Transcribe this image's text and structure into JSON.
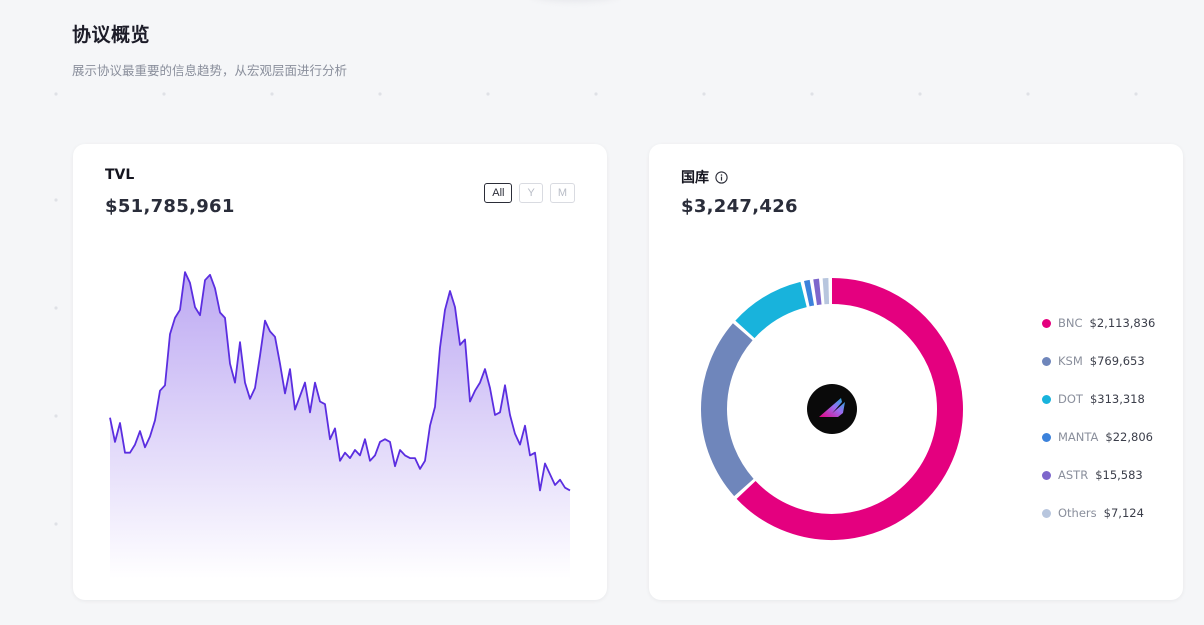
{
  "header": {
    "title": "协议概览",
    "subtitle": "展示协议最重要的信息趋势，从宏观层面进行分析"
  },
  "tvl": {
    "title": "TVL",
    "value": "$51,785,961",
    "ranges": [
      {
        "label": "All",
        "active": true
      },
      {
        "label": "Y",
        "active": false
      },
      {
        "label": "M",
        "active": false
      }
    ],
    "line_color": "#5b2ee0",
    "fill_color": "#b9a4f2"
  },
  "treasury": {
    "title": "国库",
    "info_icon": "info-circle-icon",
    "value": "$3,247,426",
    "center_logo": "bifrost-logo-icon"
  },
  "chart_data": [
    {
      "type": "area",
      "title": "TVL",
      "x": [
        0,
        5,
        10,
        15,
        20,
        25,
        30,
        35,
        40,
        45,
        50,
        55,
        60,
        65,
        70,
        75,
        80,
        85,
        90,
        95,
        100,
        105,
        110,
        115,
        120,
        125,
        130,
        135,
        140,
        145,
        150,
        155,
        160,
        165,
        170,
        175,
        180,
        185,
        190,
        195,
        200,
        205,
        210,
        215,
        220,
        225,
        230,
        235,
        240,
        245,
        250,
        255,
        260,
        265,
        270,
        275,
        280,
        285,
        290,
        295,
        300,
        305,
        310,
        315,
        320,
        325,
        330,
        335,
        340,
        345,
        350,
        355,
        360,
        365,
        370,
        375,
        380,
        385,
        390,
        395,
        400,
        405,
        410,
        415,
        420,
        425,
        430,
        435,
        440,
        445,
        450,
        455,
        460
      ],
      "y": [
        58,
        49,
        56,
        45,
        45,
        48,
        53,
        47,
        51,
        57,
        68,
        70,
        89,
        95,
        98,
        112,
        108,
        99,
        96,
        109,
        111,
        106,
        97,
        95,
        78,
        71,
        86,
        71,
        65,
        69,
        81,
        94,
        90,
        88,
        78,
        67,
        76,
        61,
        66,
        71,
        60,
        71,
        64,
        63,
        50,
        54,
        42,
        45,
        43,
        46,
        44,
        50,
        42,
        44,
        49,
        50,
        49,
        40,
        46,
        44,
        43,
        43,
        39,
        42,
        55,
        62,
        84,
        98,
        105,
        99,
        85,
        87,
        64,
        68,
        71,
        76,
        69,
        59,
        60,
        70,
        59,
        52,
        48,
        55,
        44,
        45,
        31,
        41,
        37,
        33,
        35,
        32,
        31
      ],
      "ylim": [
        0,
        115
      ]
    },
    {
      "type": "pie",
      "title": "国库",
      "total": "$3,247,426",
      "slices": [
        {
          "name": "BNC",
          "value": 2113836,
          "label": "$2,113,836",
          "color": "#e4007f"
        },
        {
          "name": "KSM",
          "value": 769653,
          "label": "$769,653",
          "color": "#6f86bb"
        },
        {
          "name": "DOT",
          "value": 313318,
          "label": "$313,318",
          "color": "#18b3dc"
        },
        {
          "name": "MANTA",
          "value": 22806,
          "label": "$22,806",
          "color": "#3c82db"
        },
        {
          "name": "ASTR",
          "value": 15583,
          "label": "$15,583",
          "color": "#7e67cc"
        },
        {
          "name": "Others",
          "value": 7124,
          "label": "$7,124",
          "color": "#b8c6de"
        }
      ]
    }
  ]
}
